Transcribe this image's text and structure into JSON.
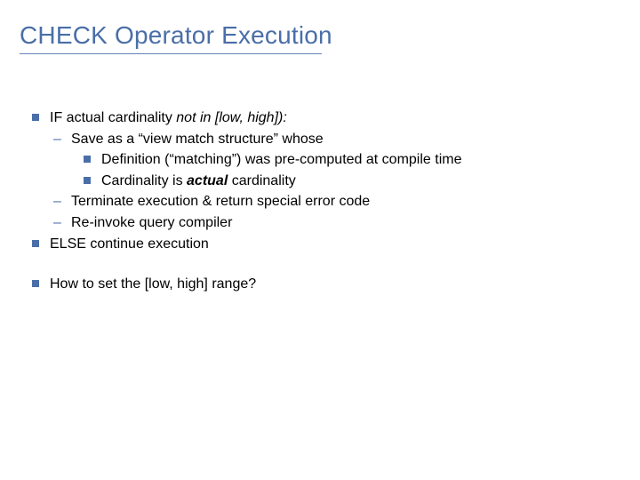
{
  "title": "CHECK Operator Execution",
  "bullets": {
    "if_line_prefix": "IF actual cardinality ",
    "if_line_italic": "not in [low, high]):",
    "save_as": "Save as a “view match structure” whose",
    "def_line": "Definition (“matching”) was pre-computed at compile time",
    "card_line_prefix": "Cardinality is ",
    "card_line_bold": "actual",
    "card_line_suffix": " cardinality",
    "terminate": "Terminate execution & return special error code",
    "reinvoke": "Re-invoke query compiler",
    "else_line": "ELSE continue execution",
    "howto": "How to set the [low, high] range?"
  }
}
